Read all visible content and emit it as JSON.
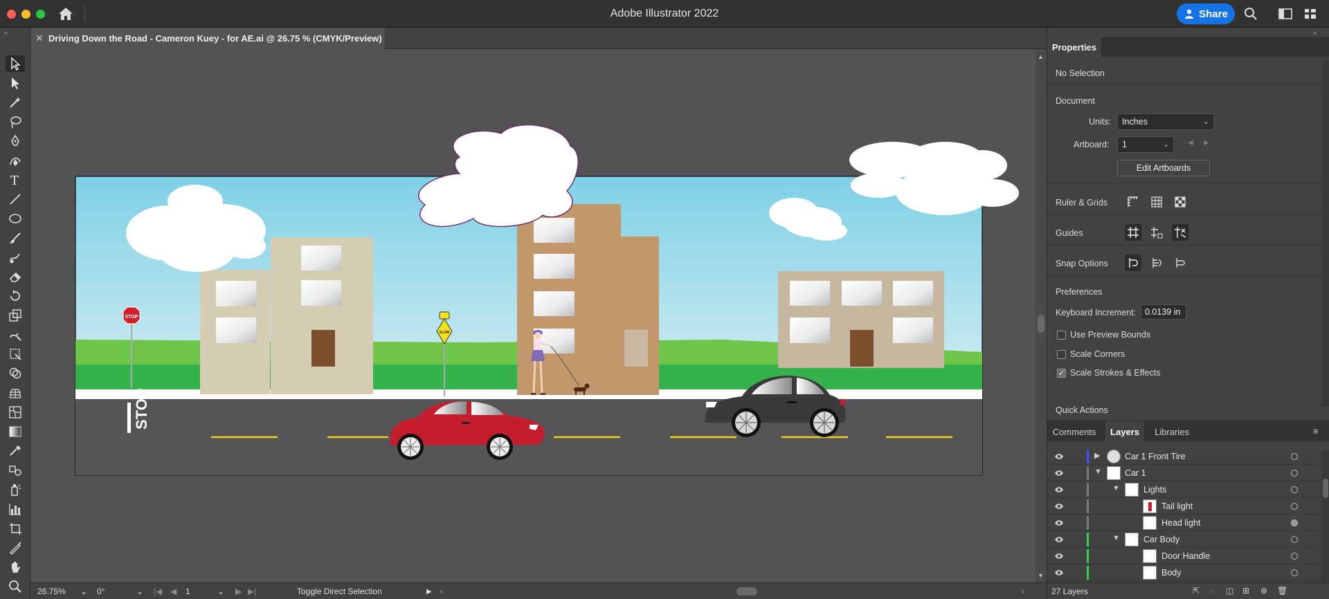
{
  "titlebar": {
    "app_title": "Adobe Illustrator 2022",
    "share_label": "Share",
    "icons": [
      "home-icon",
      "search-icon",
      "workspace-icon",
      "arrange-icon"
    ]
  },
  "document": {
    "tab_title": "Driving Down the Road - Cameron Kuey - for AE.ai @ 26.75 % (CMYK/Preview)"
  },
  "artwork": {
    "stop_sign_text": "STOP",
    "road_marking_text": "STOP",
    "school_sign_text": "SLOW"
  },
  "statusbar": {
    "zoom": "26.75%",
    "rotation": "0°",
    "artboard": "1",
    "status_text": "Toggle Direct Selection"
  },
  "properties": {
    "tab_label": "Properties",
    "selection": "No Selection",
    "document_header": "Document",
    "units_label": "Units:",
    "units_value": "Inches",
    "artboard_label": "Artboard:",
    "artboard_value": "1",
    "edit_artboards": "Edit Artboards",
    "ruler_grids": "Ruler & Grids",
    "guides": "Guides",
    "snap_options": "Snap Options",
    "preferences": "Preferences",
    "keyboard_increment_label": "Keyboard Increment:",
    "keyboard_increment_value": "0.0139 in",
    "use_preview_bounds": "Use Preview Bounds",
    "scale_corners": "Scale Corners",
    "scale_strokes": "Scale Strokes & Effects",
    "quick_actions": "Quick Actions"
  },
  "layers_panel": {
    "tabs": [
      "Comments",
      "Layers",
      "Libraries"
    ],
    "rows": [
      {
        "name": "Car 1 Front Tire",
        "color": "#4b4bff"
      },
      {
        "name": "Car 1",
        "color": "#4b4bff"
      },
      {
        "name": "Lights",
        "color": "#7a7a7a"
      },
      {
        "name": "Tail light",
        "color": "#7a7a7a"
      },
      {
        "name": "Head light",
        "color": "#7a7a7a"
      },
      {
        "name": "Car Body",
        "color": "#3ccf4e"
      },
      {
        "name": "Door Handle",
        "color": "#3ccf4e"
      },
      {
        "name": "Body",
        "color": "#3ccf4e"
      }
    ],
    "layer_count": "27 Layers"
  }
}
